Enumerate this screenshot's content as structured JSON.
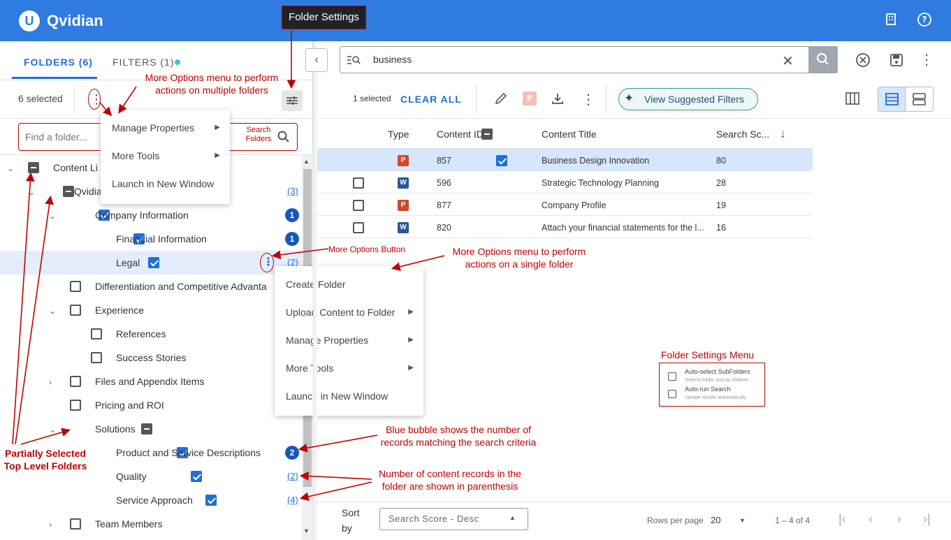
{
  "app": {
    "logo_letter": "U",
    "name": "Qvidian"
  },
  "header_icons": [
    "building-icon",
    "help-icon"
  ],
  "tabs": [
    {
      "label": "FOLDERS (6)"
    },
    {
      "label": "FILTERS (1)"
    }
  ],
  "folder_toolbar": {
    "selected_text": "6 selected"
  },
  "folder_search": {
    "placeholder": "Find a folder...",
    "search_label_line1": "Search",
    "search_label_line2": "Folders"
  },
  "tree": [
    {
      "label": "Content Li",
      "count": ""
    },
    {
      "label": "Qvidia",
      "count": "(3)"
    },
    {
      "label": "Company Information",
      "count": "1"
    },
    {
      "label": "Financial Information",
      "count": "1"
    },
    {
      "label": "Legal",
      "count": "(2)"
    },
    {
      "label": "Differentiation and Competitive Advanta",
      "count": ""
    },
    {
      "label": "Experience",
      "count": ""
    },
    {
      "label": "References",
      "count": ""
    },
    {
      "label": "Success Stories",
      "count": ""
    },
    {
      "label": "Files and Appendix Items",
      "count": ""
    },
    {
      "label": "Pricing and ROI",
      "count": ""
    },
    {
      "label": "Solutions",
      "count": ""
    },
    {
      "label": "Product and Service Descriptions",
      "count": "2"
    },
    {
      "label": "Quality",
      "count": "(2)"
    },
    {
      "label": "Service Approach",
      "count": "(4)"
    },
    {
      "label": "Team Members",
      "count": ""
    }
  ],
  "multi_menu": [
    {
      "label": "Manage Properties",
      "arrow": "▶"
    },
    {
      "label": "More Tools",
      "arrow": "▶"
    },
    {
      "label": "Launch in New Window",
      "arrow": ""
    }
  ],
  "single_menu": [
    {
      "label": "Create Folder",
      "arrow": ""
    },
    {
      "label": "Upload Content to Folder",
      "arrow": "▶"
    },
    {
      "label": "Manage Properties",
      "arrow": "▶"
    },
    {
      "label": "More Tools",
      "arrow": "▶"
    },
    {
      "label": "Launch in New Window",
      "arrow": ""
    }
  ],
  "search": {
    "value": "business"
  },
  "results_toolbar": {
    "selected_text": "1 selected",
    "clear_all": "CLEAR ALL",
    "suggested_filters": "View Suggested Filters"
  },
  "table": {
    "headers": [
      "Type",
      "Content ID",
      "Content Title",
      "Search Sc..."
    ],
    "rows": [
      {
        "type": "P",
        "id": "857",
        "title": "Business Design Innovation",
        "score": "80"
      },
      {
        "type": "W",
        "id": "596",
        "title": "Strategic Technology Planning",
        "score": "28"
      },
      {
        "type": "P",
        "id": "877",
        "title": "Company Profile",
        "score": "19"
      },
      {
        "type": "W",
        "id": "820",
        "title": "Attach your financial statements for the l...",
        "score": "16"
      }
    ]
  },
  "footer": {
    "sort_label_1": "Sort",
    "sort_label_2": "by",
    "sort_value": "Search Score - Desc",
    "rows_per_page_label": "Rows per page",
    "rows_per_page_value": "20",
    "range": "1 – 4 of 4"
  },
  "folder_settings_menu": {
    "title": "Folder Settings Menu",
    "opt1": "Auto-select SubFolders",
    "opt1_sub": "Selects folder and its children",
    "opt2": "Auto-run Search",
    "opt2_sub": "Update results automatically"
  },
  "annotations": {
    "folder_settings": "Folder Settings",
    "multi_menu_1": "More Options menu to perform",
    "multi_menu_2": "actions on multiple folders",
    "more_options_button": "More Options Button",
    "single_menu_1": "More Options menu to perform",
    "single_menu_2": "actions on a single folder",
    "bubble_1": "Blue bubble shows the number of",
    "bubble_2": "records matching the search criteria",
    "parens_1": "Number of content records in the",
    "parens_2": "folder are shown in parenthesis",
    "partial_1": "Partially Selected",
    "partial_2": "Top Level Folders"
  },
  "colors": {
    "brand": "#2f7be0",
    "accent": "#1e6fd9",
    "annotation": "#c00000",
    "highlight": "#d6e6fb"
  }
}
